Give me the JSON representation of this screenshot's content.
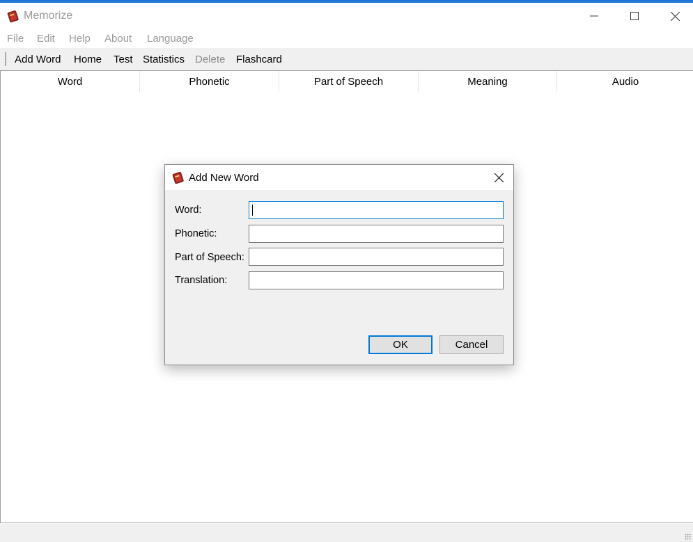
{
  "window": {
    "title": "Memorize",
    "icon": "book-icon",
    "controls": {
      "minimize": "minimize-icon",
      "maximize": "maximize-icon",
      "close": "close-icon"
    }
  },
  "menu": {
    "items": [
      "File",
      "Edit",
      "Help",
      "About",
      "Language"
    ]
  },
  "toolbar": {
    "items": [
      {
        "label": "Add Word",
        "enabled": true
      },
      {
        "label": "Home",
        "enabled": true
      },
      {
        "label": "Test",
        "enabled": true
      },
      {
        "label": "Statistics",
        "enabled": true
      },
      {
        "label": "Delete",
        "enabled": false
      },
      {
        "label": "Flashcard",
        "enabled": true
      }
    ]
  },
  "table": {
    "columns": [
      "Word",
      "Phonetic",
      "Part of Speech",
      "Meaning",
      "Audio"
    ],
    "rows": []
  },
  "dialog": {
    "title": "Add New Word",
    "icon": "book-icon",
    "fields": [
      {
        "label": "Word:",
        "value": ""
      },
      {
        "label": "Phonetic:",
        "value": ""
      },
      {
        "label": "Part of Speech:",
        "value": ""
      },
      {
        "label": "Translation:",
        "value": ""
      }
    ],
    "ok_label": "OK",
    "cancel_label": "Cancel"
  },
  "colors": {
    "accent": "#1e78d4",
    "focus": "#0078d7",
    "icon_book": "#a52a2a"
  }
}
